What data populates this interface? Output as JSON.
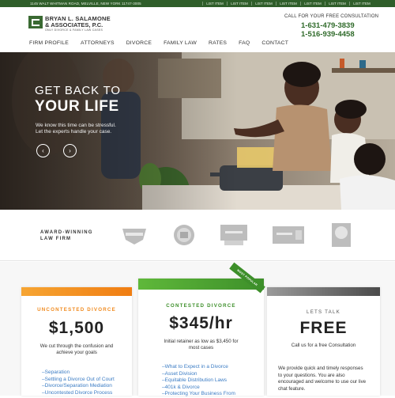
{
  "topbar": {
    "address": "1145 WALT WHITMAN ROAD, MELVILLE, NEW YORK 11747-3005",
    "links": [
      "LIST ITEM",
      "LIST ITEM",
      "LIST ITEM",
      "LIST ITEM",
      "LIST ITEM",
      "LIST ITEM",
      "LIST ITEM"
    ]
  },
  "header": {
    "logo_line1": "BRYAN L. SALAMONE",
    "logo_line2": "& ASSOCIATES, P.C.",
    "logo_tagline": "ONLY DIVORCE & FAMILY LAW CASES",
    "call_label": "CALL FOR YOUR FREE CONSULTATION",
    "phone1": "1-631-479-3839",
    "phone2": "1-516-939-4458"
  },
  "nav": {
    "items": [
      "FIRM PROFILE",
      "ATTORNEYS",
      "DIVORCE",
      "FAMILY LAW",
      "RATES",
      "FAQ",
      "CONTACT"
    ]
  },
  "hero": {
    "title_line1": "GET BACK TO",
    "title_line2": "YOUR LIFE",
    "subtitle_line1": "We know this time can be stressful.",
    "subtitle_line2": "Let the experts handle your case.",
    "prev_arrow": "‹",
    "next_arrow": "›"
  },
  "awards": {
    "label_line1": "AWARD-WINNING",
    "label_line2": "LAW FIRM"
  },
  "pricing": {
    "cards": [
      {
        "title": "UNCONTESTED DIVORCE",
        "price": "$1,500",
        "desc_line1": "We cut through the confusion and",
        "desc_line2": "achieve your goals",
        "items": [
          "Separation",
          "Settling a Divorce Out of Court",
          "Divorce/Separation Mediation",
          "Uncontested Divorce Process"
        ],
        "title_color": "#f08a1e"
      },
      {
        "title": "CONTESTED DIVORCE",
        "price": "$345/hr",
        "desc_line1": "Initial retainer as low as $3,450 for",
        "desc_line2": "most cases",
        "ribbon": "MOST POPULAR",
        "items": [
          "What to Expect in a Divorce",
          "Asset Division",
          "Equitable Distribution Laws",
          "401k & Divorce",
          "Protecting Your Business From"
        ],
        "title_color": "#3d8f2a"
      },
      {
        "title": "LETS TALK",
        "price": "FREE",
        "desc_line1": "Call us for a free Consultation",
        "body_lines": [
          "We provide quick and timely responses",
          "to your questions. You are also",
          "encouraged and welcome to use our live",
          "chat feature."
        ],
        "title_color": "#555555"
      }
    ]
  }
}
